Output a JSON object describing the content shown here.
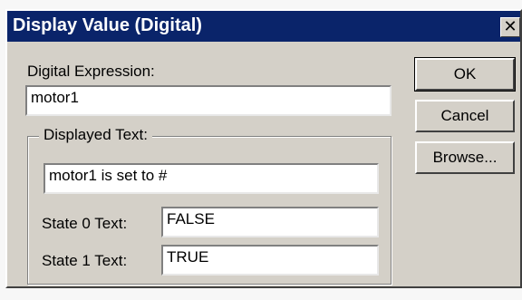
{
  "window": {
    "title": "Display Value (Digital)",
    "close_glyph": "✕"
  },
  "expression": {
    "label": "Digital Expression:",
    "value": "motor1"
  },
  "displayed_text": {
    "group_label": "Displayed Text:",
    "value": "motor1 is set to #",
    "state0_label": "State 0 Text:",
    "state0_value": "FALSE",
    "state1_label": "State 1 Text:",
    "state1_value": "TRUE"
  },
  "buttons": {
    "ok": "OK",
    "cancel": "Cancel",
    "browse": "Browse..."
  },
  "colors": {
    "titlebar": "#0a246a",
    "dialog_face": "#d4d0c8"
  }
}
